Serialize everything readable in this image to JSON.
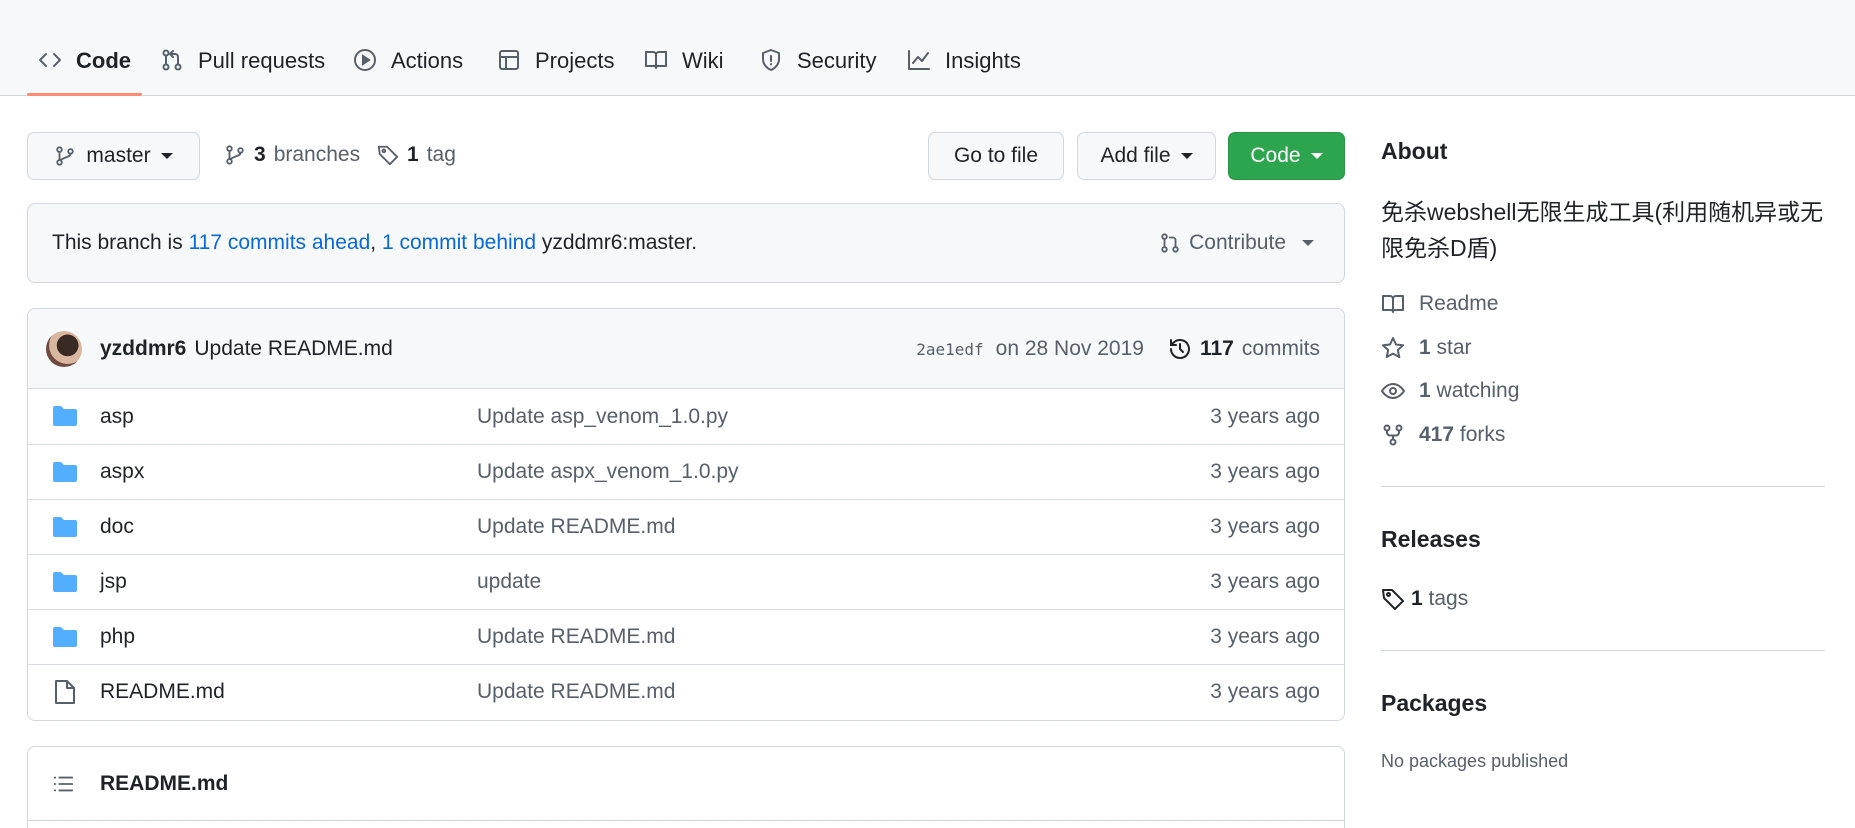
{
  "nav": {
    "tabs": [
      {
        "label": "Code",
        "icon": "code-icon",
        "selected": true
      },
      {
        "label": "Pull requests",
        "icon": "git-pull-request-icon"
      },
      {
        "label": "Actions",
        "icon": "play-icon"
      },
      {
        "label": "Projects",
        "icon": "table-icon"
      },
      {
        "label": "Wiki",
        "icon": "book-icon"
      },
      {
        "label": "Security",
        "icon": "shield-icon"
      },
      {
        "label": "Insights",
        "icon": "graph-icon"
      }
    ]
  },
  "toolbar": {
    "branch": "master",
    "branches_count": "3",
    "branches_label": "branches",
    "tags_count": "1",
    "tags_label": "tag",
    "go_to_file": "Go to file",
    "add_file": "Add file",
    "code": "Code"
  },
  "ahead": {
    "prefix": "This branch is ",
    "ahead_text": "117 commits ahead",
    "separator": ", ",
    "behind_text": "1 commit behind",
    "suffix": " yzddmr6:master.",
    "contribute": "Contribute"
  },
  "latest_commit": {
    "author": "yzddmr6",
    "message": "Update README.md",
    "sha": "2ae1edf",
    "date": "on 28 Nov 2019",
    "commits_count": "117",
    "commits_label": "commits"
  },
  "files": [
    {
      "name": "asp",
      "type": "dir",
      "commit": "Update asp_venom_1.0.py",
      "age": "3 years ago"
    },
    {
      "name": "aspx",
      "type": "dir",
      "commit": "Update aspx_venom_1.0.py",
      "age": "3 years ago"
    },
    {
      "name": "doc",
      "type": "dir",
      "commit": "Update README.md",
      "age": "3 years ago"
    },
    {
      "name": "jsp",
      "type": "dir",
      "commit": "update",
      "age": "3 years ago"
    },
    {
      "name": "php",
      "type": "dir",
      "commit": "Update README.md",
      "age": "3 years ago"
    },
    {
      "name": "README.md",
      "type": "file",
      "commit": "Update README.md",
      "age": "3 years ago"
    }
  ],
  "readme": {
    "title": "README.md"
  },
  "sidebar": {
    "about_title": "About",
    "description": "免杀webshell无限生成工具(利用随机异或无限免杀D盾)",
    "readme": "Readme",
    "stars_count": "1",
    "stars_label": "star",
    "watching_count": "1",
    "watching_label": "watching",
    "forks_count": "417",
    "forks_label": "forks",
    "releases_title": "Releases",
    "tags_count": "1",
    "tags_label": "tags",
    "packages_title": "Packages",
    "packages_empty": "No packages published"
  },
  "colors": {
    "accent_blue": "#0969da",
    "primary_green": "#2da44e",
    "selected_tab_underline": "#fd8c73",
    "folder_blue": "#54aeff"
  }
}
